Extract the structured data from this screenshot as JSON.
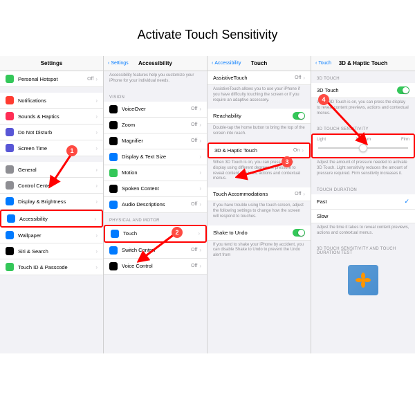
{
  "title": "Activate Touch Sensitivity",
  "panel1": {
    "title": "Settings",
    "items_g1": [
      {
        "icon": "ic-green",
        "label": "Personal Hotspot",
        "value": "Off"
      }
    ],
    "items_g2": [
      {
        "icon": "ic-red",
        "label": "Notifications"
      },
      {
        "icon": "ic-pink",
        "label": "Sounds & Haptics"
      },
      {
        "icon": "ic-purple",
        "label": "Do Not Disturb"
      },
      {
        "icon": "ic-purple",
        "label": "Screen Time"
      }
    ],
    "items_g3": [
      {
        "icon": "ic-gray",
        "label": "General"
      },
      {
        "icon": "ic-gray",
        "label": "Control Center"
      },
      {
        "icon": "ic-blue",
        "label": "Display & Brightness"
      },
      {
        "icon": "ic-blue",
        "label": "Accessibility",
        "highlight": true
      },
      {
        "icon": "ic-blue",
        "label": "Wallpaper"
      },
      {
        "icon": "ic-black",
        "label": "Siri & Search"
      },
      {
        "icon": "ic-green",
        "label": "Touch ID & Passcode"
      }
    ]
  },
  "panel2": {
    "back": "Settings",
    "title": "Accessibility",
    "hint": "Accessibility features help you customize your iPhone for your individual needs.",
    "section1": "VISION",
    "items_vision": [
      {
        "icon": "ic-black",
        "label": "VoiceOver",
        "value": "Off"
      },
      {
        "icon": "ic-black",
        "label": "Zoom",
        "value": "Off"
      },
      {
        "icon": "ic-black",
        "label": "Magnifier",
        "value": "Off"
      },
      {
        "icon": "ic-blue",
        "label": "Display & Text Size"
      },
      {
        "icon": "ic-green",
        "label": "Motion"
      },
      {
        "icon": "ic-black",
        "label": "Spoken Content"
      },
      {
        "icon": "ic-blue",
        "label": "Audio Descriptions",
        "value": "Off"
      }
    ],
    "section2": "PHYSICAL AND MOTOR",
    "items_motor": [
      {
        "icon": "ic-blue",
        "label": "Touch",
        "highlight": true
      },
      {
        "icon": "ic-blue",
        "label": "Switch Control",
        "value": "Off"
      },
      {
        "icon": "ic-black",
        "label": "Voice Control",
        "value": "Off"
      }
    ]
  },
  "panel3": {
    "back": "Accessibility",
    "title": "Touch",
    "items": [
      {
        "label": "AssistiveTouch",
        "value": "Off",
        "hint": "AssistiveTouch allows you to use your iPhone if you have difficulty touching the screen or if you require an adaptive accessory."
      },
      {
        "label": "Reachability",
        "toggle": true,
        "hint": "Double-tap the home button to bring the top of the screen into reach."
      },
      {
        "label": "3D & Haptic Touch",
        "value": "On",
        "highlight": true,
        "hint": "When 3D Touch is on, you can press on the display using different degrees of pressure to reveal content previews, actions and contextual menus."
      },
      {
        "label": "Touch Accommodations",
        "value": "Off",
        "hint": "If you have trouble using the touch screen, adjust the following settings to change how the screen will respond to touches."
      },
      {
        "label": "Shake to Undo",
        "toggle": true,
        "hint": "If you tend to shake your iPhone by accident, you can disable Shake to Undo to prevent the Undo alert from"
      }
    ]
  },
  "panel4": {
    "back": "Touch",
    "title": "3D & Haptic Touch",
    "section1": "3D TOUCH",
    "toggle_label": "3D Touch",
    "toggle_hint": "When 3D Touch is on, you can press the display to reveal content previews, actions and contextual menus.",
    "section2": "3D TOUCH SENSITIVITY",
    "slider": {
      "options": [
        "Light",
        "Medium",
        "Firm"
      ],
      "value_index": 1
    },
    "slider_hint": "Adjust the amount of pressure needed to activate 3D Touch. Light sensitivity reduces the amount of pressure required. Firm sensitivity increases it.",
    "section3": "TOUCH DURATION",
    "duration": [
      {
        "label": "Fast",
        "checked": true
      },
      {
        "label": "Slow"
      }
    ],
    "duration_hint": "Adjust the time it takes to reveal content previews, actions and contextual menus.",
    "section4": "3D TOUCH SENSITIVITY AND TOUCH DURATION TEST"
  },
  "badges": [
    "1",
    "2",
    "3",
    "4"
  ]
}
